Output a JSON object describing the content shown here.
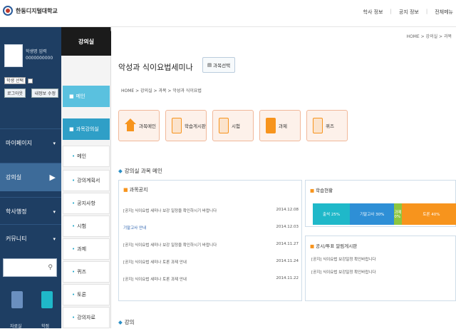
{
  "header": {
    "school": "한동디지털대학교",
    "links": [
      "학사 정보",
      "공지 정보",
      "전체메뉴"
    ]
  },
  "sidebar": {
    "profile": {
      "name_lines": [
        "학생명 입력",
        "0000000000"
      ],
      "select_label": "학생 선택",
      "button_left": "로그아웃",
      "button_right": "내정보 수정"
    },
    "nav": [
      {
        "label": "마이페이지",
        "active": false
      },
      {
        "label": "강의실",
        "active": true
      },
      {
        "label": "학사행정",
        "active": false
      },
      {
        "label": "커뮤니티",
        "active": false
      }
    ],
    "search_placeholder": "",
    "quick_links": [
      "자료실",
      "학점"
    ]
  },
  "menu2": {
    "title": "강의실",
    "items": [
      {
        "label": "메인",
        "level": 1,
        "active": false
      },
      {
        "label": "과목강의실",
        "level": 1,
        "active": true
      },
      {
        "label": "메인",
        "level": 2
      },
      {
        "label": "강의계획서",
        "level": 2
      },
      {
        "label": "공지사항",
        "level": 2
      },
      {
        "label": "시험",
        "level": 2
      },
      {
        "label": "과제",
        "level": 2
      },
      {
        "label": "퀴즈",
        "level": 2
      },
      {
        "label": "토론",
        "level": 2
      },
      {
        "label": "강의자료",
        "level": 2
      }
    ]
  },
  "main": {
    "top_crumb": "HOME > 강의실 > 과목",
    "title": "악성과 식이요법세미나",
    "tag": "과목선택",
    "crumb": "HOME > 강의실 > 과목 > 악성과 식이요법",
    "tiles": [
      {
        "label": "과목메인",
        "icon": "home-icon"
      },
      {
        "label": "학습게시판",
        "icon": "board-icon"
      },
      {
        "label": "시험",
        "icon": "exam-icon"
      },
      {
        "label": "과제",
        "icon": "assignment-icon"
      },
      {
        "label": "퀴즈",
        "icon": "quiz-icon"
      }
    ],
    "section_title": "강의실 과목 메인",
    "notices": {
      "title": "과목공지",
      "rows": [
        {
          "text": "[공지] 식이요법 세미나 보강 일정을 확인하시기 바랍니다",
          "date": "2014.12.08",
          "highlight": false
        },
        {
          "text": "기말고사 안내",
          "date": "2014.12.03",
          "highlight": true
        },
        {
          "text": "[공지] 식이요법 세미나 보강 일정을 확인하시기 바랍니다",
          "date": "2014.11.27",
          "highlight": false
        },
        {
          "text": "[공지] 식이요법 세미나 토론 과제 안내",
          "date": "2014.11.24",
          "highlight": false
        },
        {
          "text": "[공지] 식이요법 세미나 토론 과제 안내",
          "date": "2014.11.22",
          "highlight": false
        }
      ]
    },
    "status": {
      "title": "학습현황",
      "segments": [
        {
          "label": "출석 25%",
          "value": 25,
          "color": "#1fb8c9"
        },
        {
          "label": "기말고사 30%",
          "value": 30,
          "color": "#2e8fd6"
        },
        {
          "label": "과제 0%",
          "value": 5,
          "color": "#8dc63f"
        },
        {
          "label": "토론 40%",
          "value": 40,
          "color": "#f7941d"
        }
      ]
    },
    "qna": {
      "title": "공시/투표 알림게시판",
      "rows": [
        "[공지] 식이요법 보강일정 확인바랍니다",
        "[공지] 식이요법 보강일정 확인바랍니다"
      ]
    },
    "bottom_section": "강의"
  }
}
